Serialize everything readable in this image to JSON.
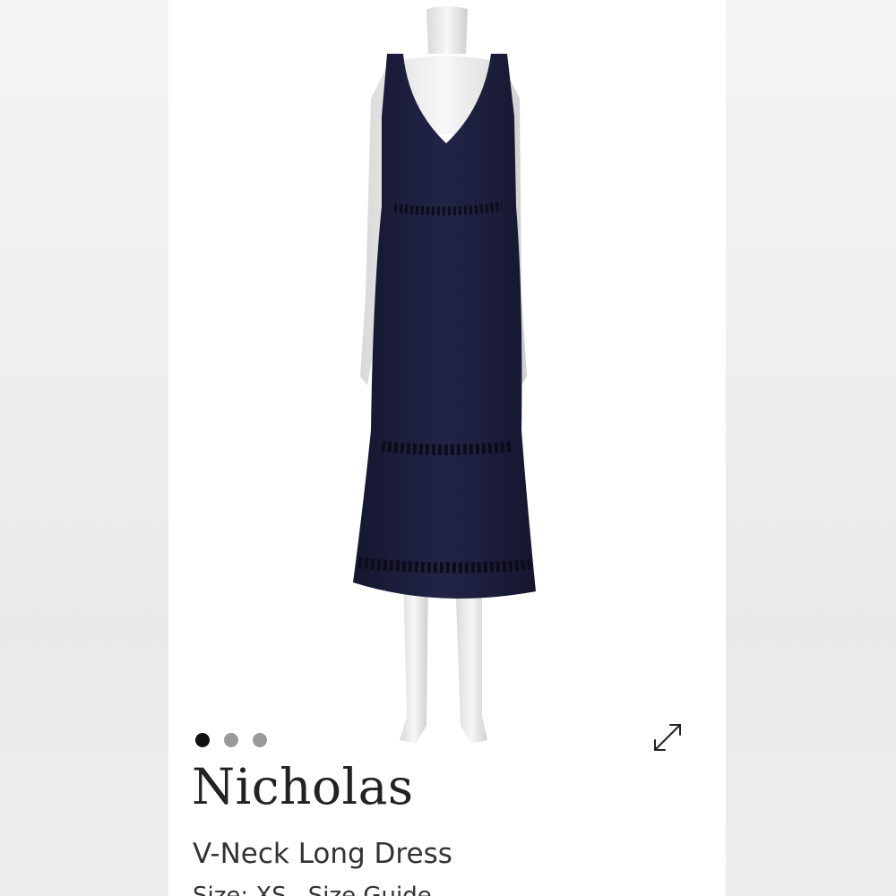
{
  "listing": {
    "brand": "Nicholas",
    "product_title": "V-Neck Long Dress",
    "size_label": "Size: XS",
    "size_guide_label": "Size Guide"
  },
  "carousel": {
    "slide_count": 3,
    "active_index": 0
  },
  "icons": {
    "expand": "expand-arrows-icon"
  },
  "colors": {
    "dress": "#1c1d3c",
    "active_dot": "#111111",
    "inactive_dot": "#9a9a9a"
  }
}
